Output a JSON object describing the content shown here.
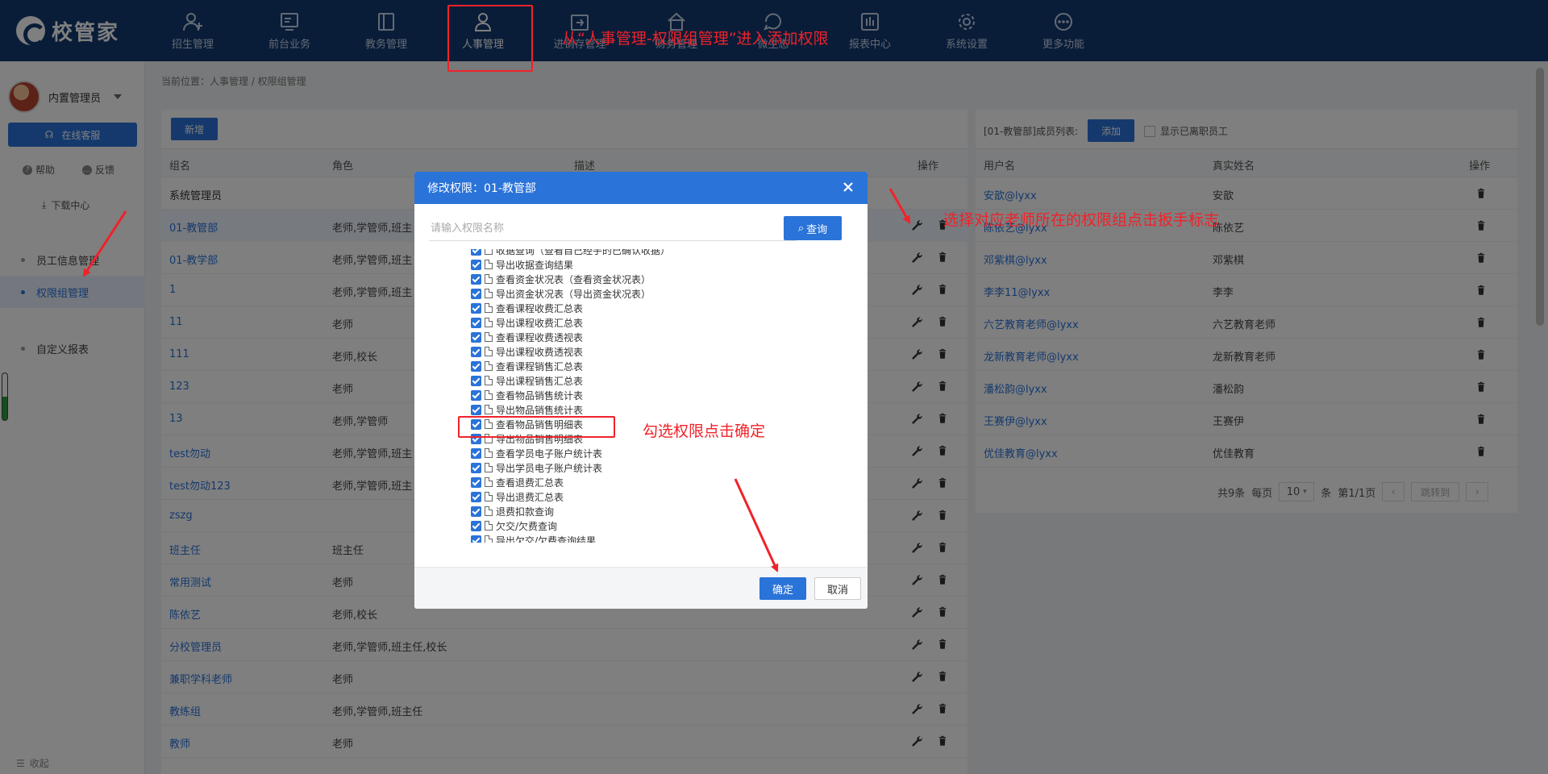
{
  "logo_text": "校管家",
  "nav": [
    {
      "label": "招生管理",
      "icon": "user-plus-icon"
    },
    {
      "label": "前台业务",
      "icon": "monitor-icon"
    },
    {
      "label": "教务管理",
      "icon": "book-icon"
    },
    {
      "label": "人事管理",
      "icon": "person-icon"
    },
    {
      "label": "进销存管理",
      "icon": "box-icon"
    },
    {
      "label": "财务管理",
      "icon": "home-icon"
    },
    {
      "label": "微生态",
      "icon": "chat-icon"
    },
    {
      "label": "报表中心",
      "icon": "chart-icon"
    },
    {
      "label": "系统设置",
      "icon": "gear-icon"
    },
    {
      "label": "更多功能",
      "icon": "more-icon"
    }
  ],
  "sidebar": {
    "user_name": "内置管理员",
    "online_service": "在线客服",
    "help": "帮助",
    "feedback": "反馈",
    "download_center": "下载中心",
    "menu": [
      {
        "label": "员工信息管理"
      },
      {
        "label": "权限组管理"
      },
      {
        "label": "自定义报表"
      }
    ],
    "collapse": "收起"
  },
  "breadcrumb": "当前位置：人事管理 / 权限组管理",
  "groups": {
    "new_button": "新增",
    "headers": {
      "name": "组名",
      "role": "角色",
      "desc": "描述",
      "ops": "操作"
    },
    "rows": [
      {
        "name": "系统管理员",
        "role": ""
      },
      {
        "name": "01-教管部",
        "role": "老师,学管师,班主"
      },
      {
        "name": "01-教学部",
        "role": "老师,学管师,班主"
      },
      {
        "name": "1",
        "role": "老师,学管师,班主"
      },
      {
        "name": "11",
        "role": "老师"
      },
      {
        "name": "111",
        "role": "老师,校长"
      },
      {
        "name": "123",
        "role": "老师"
      },
      {
        "name": "13",
        "role": "老师,学管师"
      },
      {
        "name": "test勿动",
        "role": "老师,学管师,班主"
      },
      {
        "name": "test勿动123",
        "role": "老师,学管师,班主"
      },
      {
        "name": "zszg",
        "role": ""
      },
      {
        "name": "班主任",
        "role": "班主任"
      },
      {
        "name": "常用测试",
        "role": "老师"
      },
      {
        "name": "陈依艺",
        "role": "老师,校长"
      },
      {
        "name": "分校管理员",
        "role": "老师,学管师,班主任,校长"
      },
      {
        "name": "兼职学科老师",
        "role": "老师"
      },
      {
        "name": "教练组",
        "role": "老师,学管师,班主任"
      },
      {
        "name": "教师",
        "role": "老师"
      }
    ]
  },
  "members": {
    "title": "[01-教管部]成员列表:",
    "add_button": "添加",
    "show_resigned": "显示已离职员工",
    "headers": {
      "user": "用户名",
      "real": "真实姓名",
      "ops": "操作"
    },
    "rows": [
      {
        "user": "安歆@lyxx",
        "real": "安歆"
      },
      {
        "user": "陈依艺@lyxx",
        "real": "陈依艺"
      },
      {
        "user": "邓紫棋@lyxx",
        "real": "邓紫棋"
      },
      {
        "user": "李李11@lyxx",
        "real": "李李"
      },
      {
        "user": "六艺教育老师@lyxx",
        "real": "六艺教育老师"
      },
      {
        "user": "龙新教育老师@lyxx",
        "real": "龙新教育老师"
      },
      {
        "user": "潘松韵@lyxx",
        "real": "潘松韵"
      },
      {
        "user": "王赛伊@lyxx",
        "real": "王赛伊"
      },
      {
        "user": "优佳教育@lyxx",
        "real": "优佳教育"
      }
    ],
    "pager": {
      "total": "共9条",
      "per_page": "每页",
      "size": "10",
      "unit": "条",
      "page": "第1/1页",
      "jump": "跳转到"
    }
  },
  "modal": {
    "title": "修改权限：01-教管部",
    "search_placeholder": "请输入权限名称",
    "search_button": "查询",
    "permissions": [
      "收据查询（查看自己经手的已确认收据）",
      "导出收据查询结果",
      "查看资金状况表（查看资金状况表）",
      "导出资金状况表（导出资金状况表）",
      "查看课程收费汇总表",
      "导出课程收费汇总表",
      "查看课程收费透视表",
      "导出课程收费透视表",
      "查看课程销售汇总表",
      "导出课程销售汇总表",
      "查看物品销售统计表",
      "导出物品销售统计表",
      "查看物品销售明细表",
      "导出物品销售明细表",
      "查看学员电子账户统计表",
      "导出学员电子账户统计表",
      "查看退费汇总表",
      "导出退费汇总表",
      "退费扣款查询",
      "欠交/欠费查询",
      "导出欠交/欠费查询结果"
    ],
    "ok": "确定",
    "cancel": "取消"
  },
  "annotations": {
    "top": "从“人事管理-权限组管理”进入添加权限",
    "wrench": "选择对应老师所在的权限组点击扳手标志",
    "check": "勾选权限点击确定"
  },
  "colors": {
    "annotation": "#f0222a",
    "primary": "#2a73d9",
    "topbar": "#133a73"
  }
}
